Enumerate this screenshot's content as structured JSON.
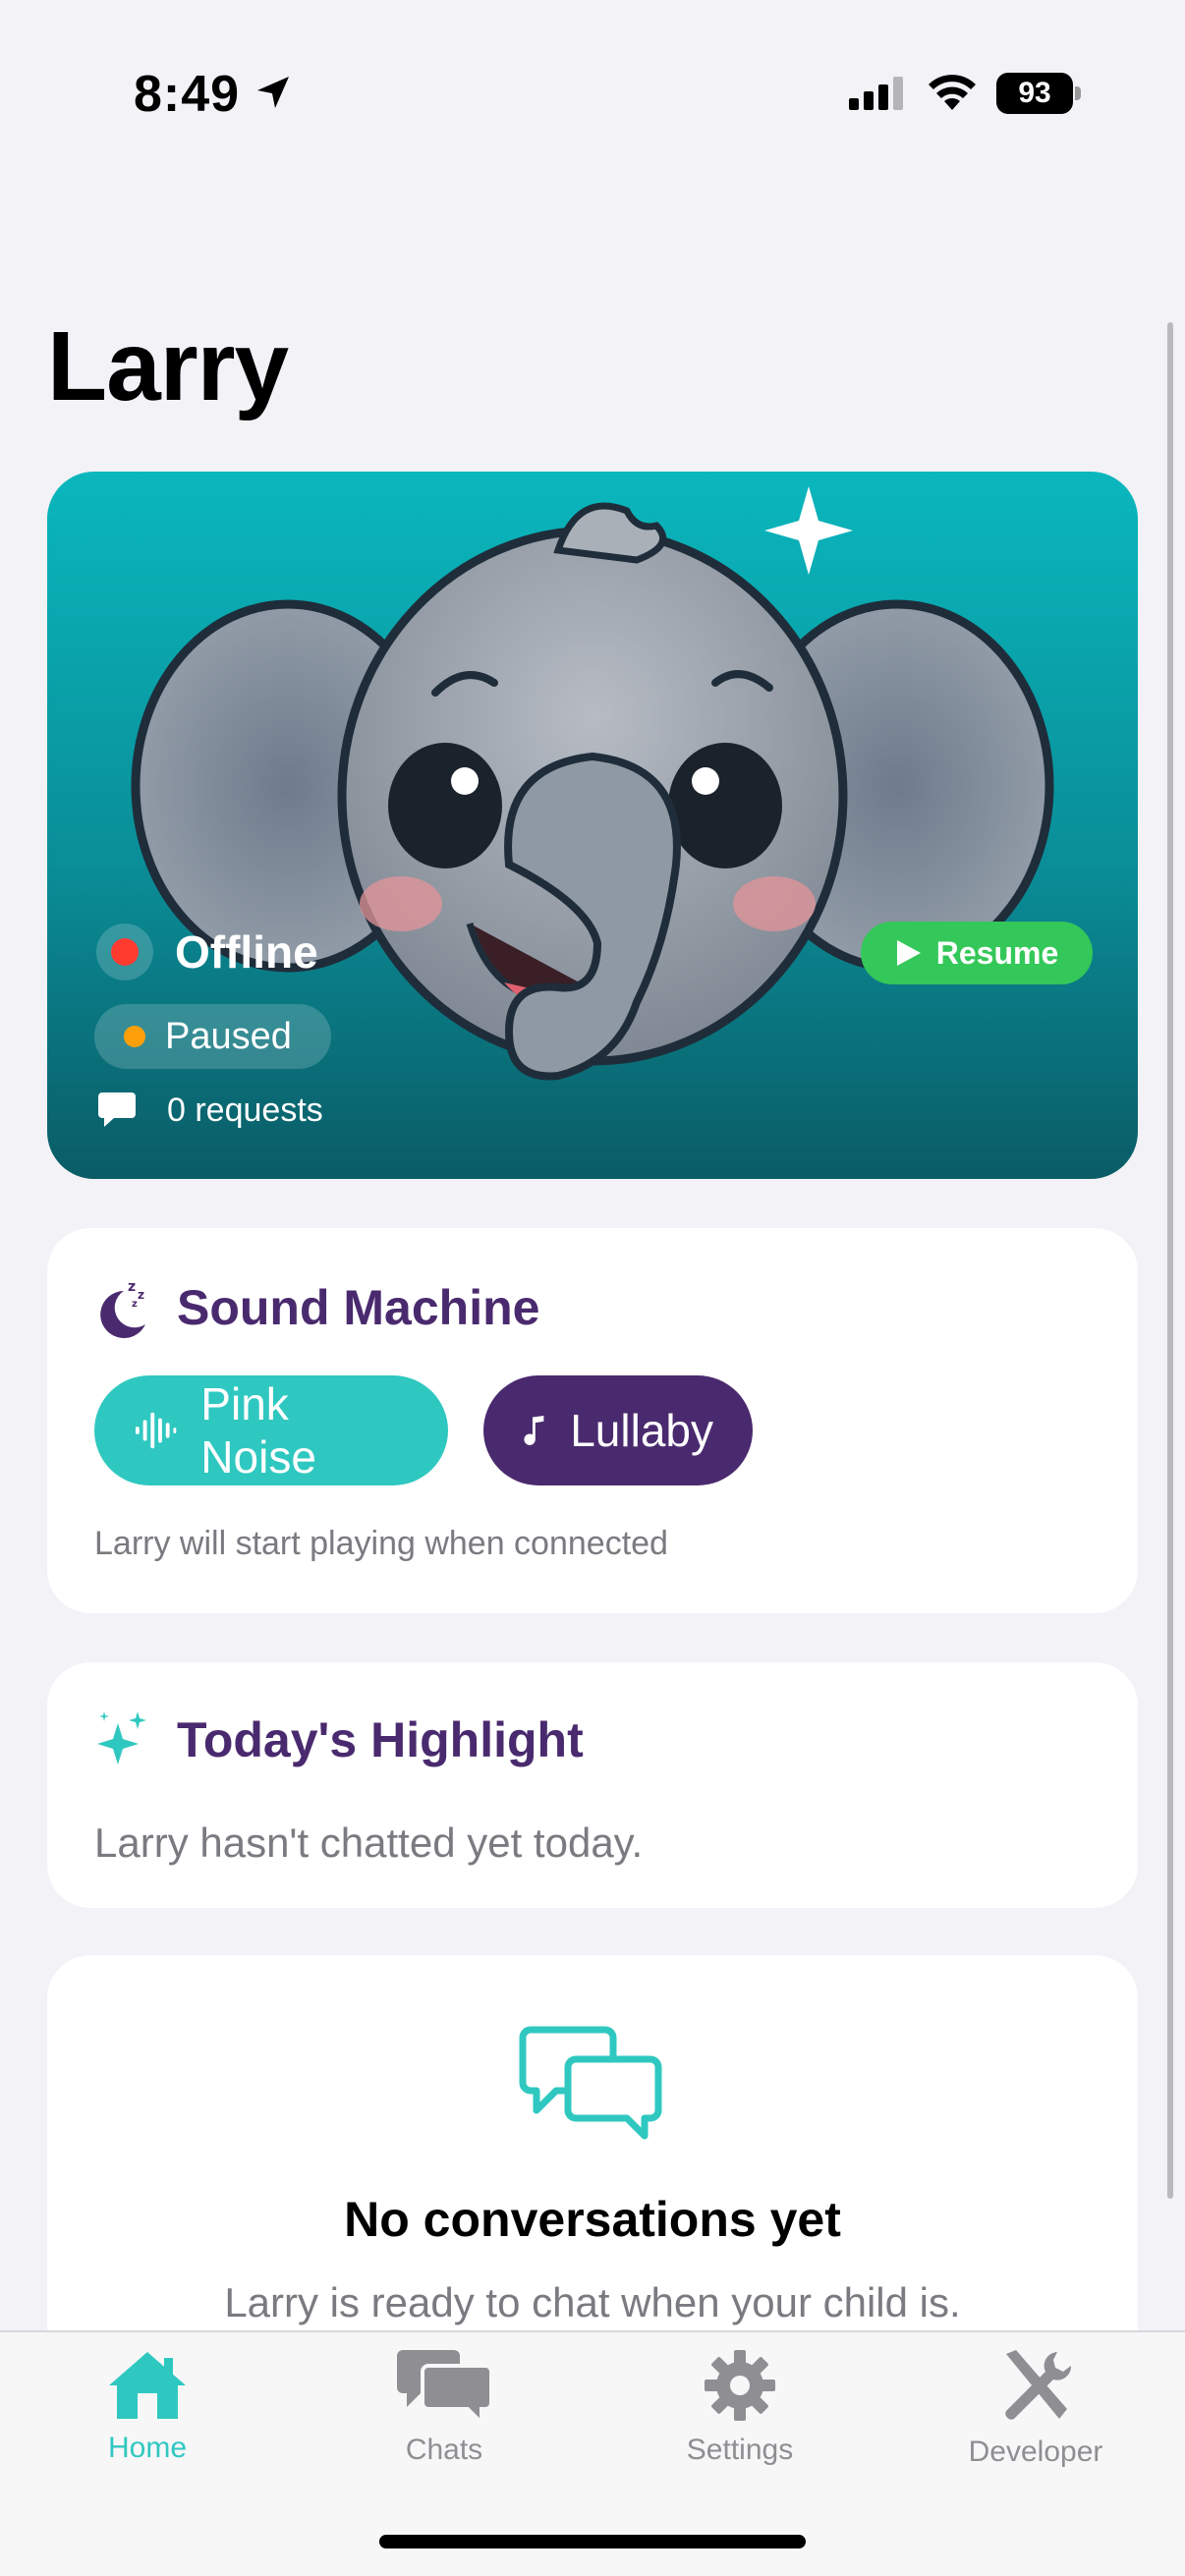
{
  "status_bar": {
    "time": "8:49",
    "battery": "93"
  },
  "page": {
    "title": "Larry"
  },
  "hero": {
    "connection_status": "Offline",
    "state_label": "Paused",
    "requests_text": "0 requests",
    "resume_label": "Resume"
  },
  "sound_machine": {
    "title": "Sound Machine",
    "options": [
      "Pink Noise",
      "Lullaby"
    ],
    "note": "Larry will start playing when connected"
  },
  "highlight": {
    "title": "Today's Highlight",
    "text": "Larry hasn't chatted yet today."
  },
  "empty_state": {
    "title": "No conversations yet",
    "subtitle": "Larry is ready to chat when your child is."
  },
  "tab_bar": {
    "tabs": [
      {
        "label": "Home",
        "icon": "home-icon",
        "active": true
      },
      {
        "label": "Chats",
        "icon": "chats-icon",
        "active": false
      },
      {
        "label": "Settings",
        "icon": "gear-icon",
        "active": false
      },
      {
        "label": "Developer",
        "icon": "tools-icon",
        "active": false
      }
    ]
  },
  "colors": {
    "accent": "#2fc8c0",
    "purple": "#4a2a6e",
    "resume_green": "#34c759",
    "offline_red": "#ff3b30",
    "paused_orange": "#ff9f0a"
  }
}
